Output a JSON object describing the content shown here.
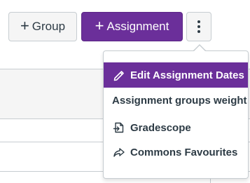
{
  "toolbar": {
    "group_button": {
      "plus": "+",
      "label": "Group"
    },
    "assignment_button": {
      "plus": "+",
      "label": "Assignment"
    },
    "more_button": {
      "icon": "kebab-menu-icon"
    }
  },
  "menu": {
    "items": [
      {
        "label": "Edit Assignment Dates",
        "icon": "pencil-icon",
        "active": true
      },
      {
        "label": "Assignment groups weight",
        "icon": "",
        "active": false
      },
      {
        "label": "Gradescope",
        "icon": "external-tool-icon",
        "active": false
      },
      {
        "label": "Commons Favourites",
        "icon": "share-icon",
        "active": false
      }
    ]
  },
  "colors": {
    "brand_purple": "#6b2f9a",
    "text": "#2d3b45",
    "border": "#c7cdd1",
    "button_bg": "#f5f5f5"
  }
}
